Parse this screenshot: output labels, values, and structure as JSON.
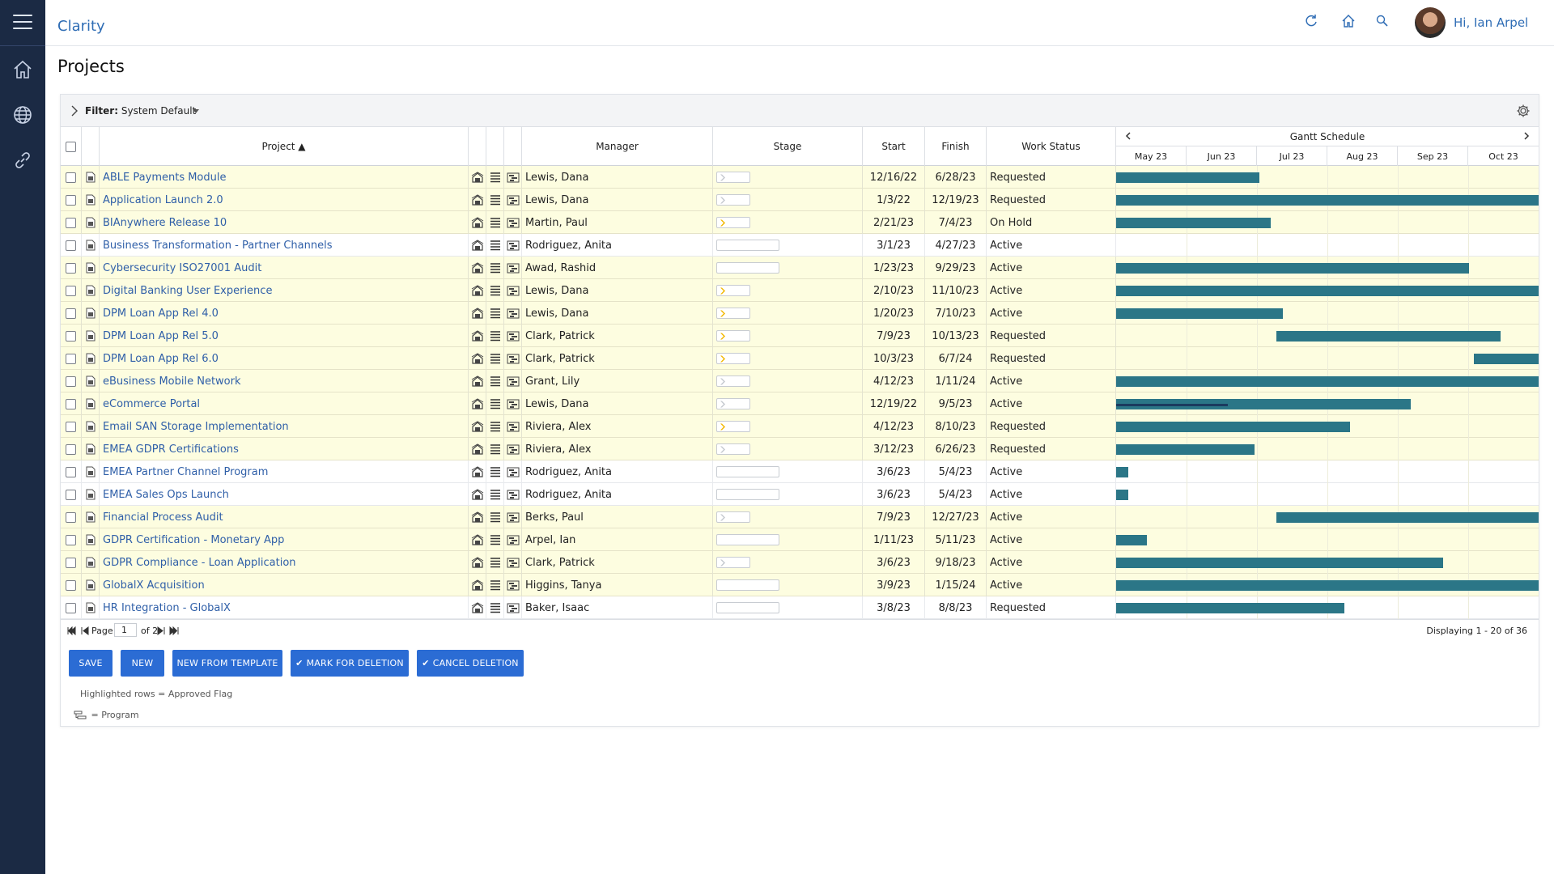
{
  "app": {
    "brand": "Clarity",
    "greeting": "Hi, Ian Arpel"
  },
  "page": {
    "title": "Projects"
  },
  "filter": {
    "label": "Filter:",
    "value": "System Default"
  },
  "columns": {
    "project": "Project ▲",
    "manager": "Manager",
    "stage": "Stage",
    "start": "Start",
    "finish": "Finish",
    "work_status": "Work Status",
    "gantt_title": "Gantt Schedule",
    "months": [
      "May 23",
      "Jun 23",
      "Jul 23",
      "Aug 23",
      "Sep 23",
      "Oct 23"
    ]
  },
  "rows": [
    {
      "project": "ABLE Payments Module",
      "manager": "Lewis, Dana",
      "start": "12/16/22",
      "finish": "6/28/23",
      "status": "Requested",
      "approved": true,
      "stage": "grey",
      "gantt": [
        0,
        0.34
      ]
    },
    {
      "project": "Application Launch 2.0",
      "manager": "Lewis, Dana",
      "start": "1/3/22",
      "finish": "12/19/23",
      "status": "Requested",
      "approved": true,
      "stage": "grey",
      "gantt": [
        0,
        1
      ]
    },
    {
      "project": "BIAnywhere Release 10",
      "manager": "Martin, Paul",
      "start": "2/21/23",
      "finish": "7/4/23",
      "status": "On Hold",
      "approved": true,
      "stage": "yellow",
      "gantt": [
        0,
        0.365
      ]
    },
    {
      "project": "Business Transformation - Partner Channels",
      "manager": "Rodriguez, Anita",
      "start": "3/1/23",
      "finish": "4/27/23",
      "status": "Active",
      "approved": false,
      "stage": "none",
      "gantt": null
    },
    {
      "project": "Cybersecurity ISO27001 Audit",
      "manager": "Awad, Rashid",
      "start": "1/23/23",
      "finish": "9/29/23",
      "status": "Active",
      "approved": true,
      "stage": "none",
      "gantt": [
        0,
        0.835
      ]
    },
    {
      "project": "Digital Banking User Experience",
      "manager": "Lewis, Dana",
      "start": "2/10/23",
      "finish": "11/10/23",
      "status": "Active",
      "approved": true,
      "stage": "yellow",
      "gantt": [
        0,
        1
      ]
    },
    {
      "project": "DPM Loan App Rel 4.0",
      "manager": "Lewis, Dana",
      "start": "1/20/23",
      "finish": "7/10/23",
      "status": "Active",
      "approved": true,
      "stage": "yellow",
      "gantt": [
        0,
        0.395
      ]
    },
    {
      "project": "DPM Loan App Rel 5.0",
      "manager": "Clark, Patrick",
      "start": "7/9/23",
      "finish": "10/13/23",
      "status": "Requested",
      "approved": true,
      "stage": "yellow",
      "gantt": [
        0.38,
        0.91
      ]
    },
    {
      "project": "DPM Loan App Rel 6.0",
      "manager": "Clark, Patrick",
      "start": "10/3/23",
      "finish": "6/7/24",
      "status": "Requested",
      "approved": true,
      "stage": "yellow",
      "gantt": [
        0.847,
        1
      ]
    },
    {
      "project": "eBusiness Mobile Network",
      "manager": "Grant, Lily",
      "start": "4/12/23",
      "finish": "1/11/24",
      "status": "Active",
      "approved": true,
      "stage": "grey",
      "gantt": [
        0,
        1
      ]
    },
    {
      "project": "eCommerce Portal",
      "manager": "Lewis, Dana",
      "start": "12/19/22",
      "finish": "9/5/23",
      "status": "Active",
      "approved": true,
      "stage": "grey",
      "gantt": [
        0,
        0.697
      ],
      "progress": 0.265
    },
    {
      "project": "Email SAN Storage Implementation",
      "manager": "Riviera, Alex",
      "start": "4/12/23",
      "finish": "8/10/23",
      "status": "Requested",
      "approved": true,
      "stage": "yellow",
      "gantt": [
        0,
        0.553
      ]
    },
    {
      "project": "EMEA GDPR Certifications",
      "manager": "Riviera, Alex",
      "start": "3/12/23",
      "finish": "6/26/23",
      "status": "Requested",
      "approved": true,
      "stage": "grey",
      "gantt": [
        0,
        0.328
      ]
    },
    {
      "project": "EMEA Partner Channel Program",
      "manager": "Rodriguez, Anita",
      "start": "3/6/23",
      "finish": "5/4/23",
      "status": "Active",
      "approved": false,
      "stage": "none",
      "gantt": [
        0,
        0.029
      ]
    },
    {
      "project": "EMEA Sales Ops Launch",
      "manager": "Rodriguez, Anita",
      "start": "3/6/23",
      "finish": "5/4/23",
      "status": "Active",
      "approved": false,
      "stage": "none",
      "gantt": [
        0,
        0.029
      ]
    },
    {
      "project": "Financial Process Audit",
      "manager": "Berks, Paul",
      "start": "7/9/23",
      "finish": "12/27/23",
      "status": "Active",
      "approved": true,
      "stage": "grey",
      "gantt": [
        0.38,
        1
      ]
    },
    {
      "project": "GDPR Certification - Monetary App",
      "manager": "Arpel, Ian",
      "start": "1/11/23",
      "finish": "5/11/23",
      "status": "Active",
      "approved": true,
      "stage": "none",
      "gantt": [
        0,
        0.072
      ]
    },
    {
      "project": "GDPR Compliance - Loan Application",
      "manager": "Clark, Patrick",
      "start": "3/6/23",
      "finish": "9/18/23",
      "status": "Active",
      "approved": true,
      "stage": "grey",
      "gantt": [
        0,
        0.773
      ]
    },
    {
      "project": "GlobalX Acquisition",
      "manager": "Higgins, Tanya",
      "start": "3/9/23",
      "finish": "1/15/24",
      "status": "Active",
      "approved": true,
      "stage": "none",
      "gantt": [
        0,
        1
      ]
    },
    {
      "project": "HR Integration - GlobalX",
      "manager": "Baker, Isaac",
      "start": "3/8/23",
      "finish": "8/8/23",
      "status": "Requested",
      "approved": false,
      "stage": "none",
      "gantt": [
        0,
        0.54
      ]
    }
  ],
  "pager": {
    "page_label": "Page",
    "page_value": "1",
    "of_label": "of 2",
    "display": "Displaying 1 - 20 of 36"
  },
  "buttons": {
    "save": "SAVE",
    "new": "NEW",
    "new_from_template": "NEW FROM TEMPLATE",
    "mark_for_deletion": "MARK FOR DELETION",
    "cancel_deletion": "CANCEL DELETION"
  },
  "legend": {
    "highlighted": "Highlighted rows = Approved Flag",
    "program": "= Program"
  },
  "colors": {
    "gantt_bar": "#2b7687",
    "approved_row": "#fdfde0",
    "button": "#2b6cd4",
    "link": "#2f5fa8",
    "rail": "#1b2a44"
  }
}
